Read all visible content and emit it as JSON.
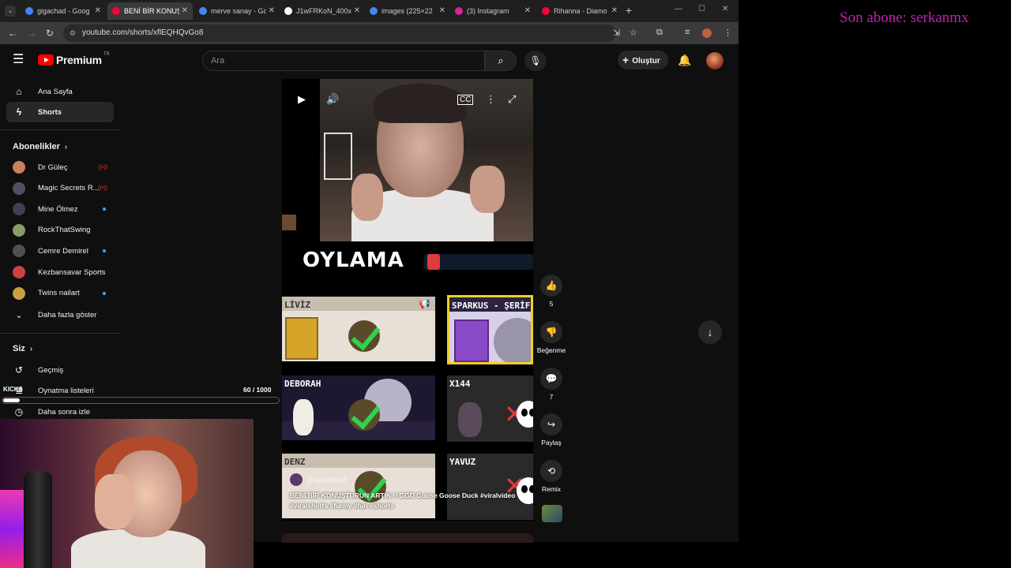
{
  "browser": {
    "tabs": [
      {
        "label": "gigachad - Goog",
        "color": "#4285f4",
        "active": false
      },
      {
        "label": "BENİ BİR KONUŞ",
        "color": "#ff0033",
        "active": true
      },
      {
        "label": "merve sanay - Go",
        "color": "#4285f4",
        "active": false
      },
      {
        "label": "J1wFRKoN_400x4",
        "color": "#ffffff",
        "active": false
      },
      {
        "label": "images (225×22",
        "color": "#4285f4",
        "active": false
      },
      {
        "label": "(3) Instagram",
        "color": "#d6249f",
        "active": false
      },
      {
        "label": "Rihanna - Diamo",
        "color": "#ff0033",
        "active": false
      }
    ],
    "url": "youtube.com/shorts/xflEQHQvGo8"
  },
  "header": {
    "brand": "Premium",
    "country": "TR",
    "search_placeholder": "Ara",
    "create_label": "Oluştur"
  },
  "sidebar": {
    "main": [
      {
        "label": "Ana Sayfa",
        "icon": "home-icon"
      },
      {
        "label": "Shorts",
        "icon": "shorts-icon"
      }
    ],
    "subs_title": "Abonelikler",
    "subs": [
      {
        "label": "Dr Güleç",
        "badge": "live"
      },
      {
        "label": "Magic Secrets R...",
        "badge": "live"
      },
      {
        "label": "Mine Ölmez",
        "badge": "dot"
      },
      {
        "label": "RockThatSwing",
        "badge": ""
      },
      {
        "label": "Cemre Demirel",
        "badge": "dot"
      },
      {
        "label": "Kezbansavar Sports",
        "badge": ""
      },
      {
        "label": "Twins nailart",
        "badge": "dot"
      }
    ],
    "show_more": "Daha fazla göster",
    "you_title": "Siz",
    "you": [
      {
        "label": "Geçmiş",
        "icon": "history-icon"
      },
      {
        "label": "Oynatma listeleri",
        "icon": "playlist-icon"
      },
      {
        "label": "Daha sonra izle",
        "icon": "clock-icon"
      }
    ]
  },
  "short": {
    "vote_title": "OYLAMA",
    "cards": [
      {
        "name": "LİVİZ"
      },
      {
        "name": "SPARKUS - ŞERİF"
      },
      {
        "name": "DEBORAH"
      },
      {
        "name": "X144"
      },
      {
        "name": "DENZ"
      },
      {
        "name": "YAVUZ"
      }
    ],
    "channel": "@sparkusyt",
    "title": "BENİ BİR KONUŞTURUN ARTIK !! GGD Goose Goose Duck #viralvideo #viralshorts #funny #fun #shorts",
    "progress": 0.92
  },
  "actions": {
    "likes": "5",
    "dislike_label": "Beğenme",
    "comments": "7",
    "share_label": "Paylaş",
    "remix_label": "Remix"
  },
  "stream": {
    "last_sub": "Son abone: serkanmx",
    "kicks_label": "KICKS",
    "kicks_count": "60  / 1000",
    "kicks_progress": 0.06
  }
}
